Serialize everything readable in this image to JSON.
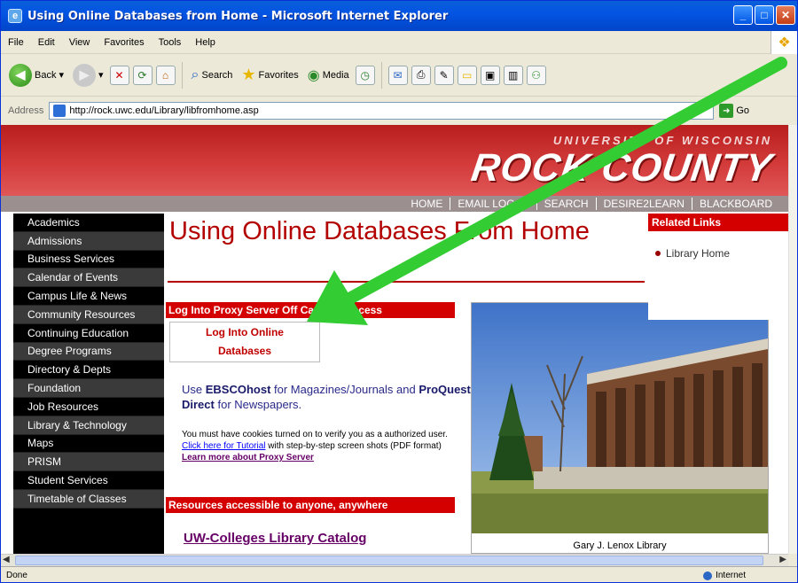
{
  "window": {
    "title": "Using Online Databases from Home - Microsoft Internet Explorer"
  },
  "menu": [
    "File",
    "Edit",
    "View",
    "Favorites",
    "Tools",
    "Help"
  ],
  "toolbar": {
    "back": "Back",
    "search": "Search",
    "favorites": "Favorites",
    "media": "Media"
  },
  "address": {
    "label": "Address",
    "url": "http://rock.uwc.edu/Library/libfromhome.asp",
    "go": "Go"
  },
  "banner": {
    "university": "UNIVERSITY OF WISCONSIN",
    "campus": "ROCK COUNTY"
  },
  "topnav": [
    "HOME",
    "EMAIL LOG-IN",
    "SEARCH",
    "DESIRE2LEARN",
    "BLACKBOARD"
  ],
  "leftnav": [
    "Academics",
    "Admissions",
    "Business Services",
    "Calendar of Events",
    "Campus Life & News",
    "Community Resources",
    "Continuing Education",
    "Degree Programs",
    "Directory & Depts",
    "Foundation",
    "Job Resources",
    "Library & Technology",
    "Maps",
    "PRISM",
    "Student Services",
    "Timetable of Classes"
  ],
  "main": {
    "title": "Using Online Databases From Home",
    "proxy_header": "Log Into Proxy Server Off Campus Access",
    "login_line1": "Log Into Online",
    "login_line2": "Databases",
    "use_text_1": "Use ",
    "use_ebsco": "EBSCOhost",
    "use_text_2": " for Magazines/Journals and ",
    "use_proquest": "ProQuest Direct",
    "use_text_3": " for Newspapers.",
    "cookie_1": "You must have cookies turned on to verify you as a authorized user.",
    "cookie_link": "Click here for Tutorial",
    "cookie_2": " with step-by-step screen shots (PDF format)",
    "learn_more": "Learn more about Proxy Server",
    "resources_header": "Resources accessible to anyone, anywhere",
    "catalog_link": "UW-Colleges Library Catalog",
    "photo_caption": "Gary J. Lenox Library"
  },
  "related": {
    "header": "Related Links",
    "item": "Library Home"
  },
  "status": {
    "left": "Done",
    "zone": "Internet"
  },
  "colors": {
    "accent_red": "#d40000",
    "arrow_green": "#33cc33",
    "xp_blue": "#0454e3"
  }
}
